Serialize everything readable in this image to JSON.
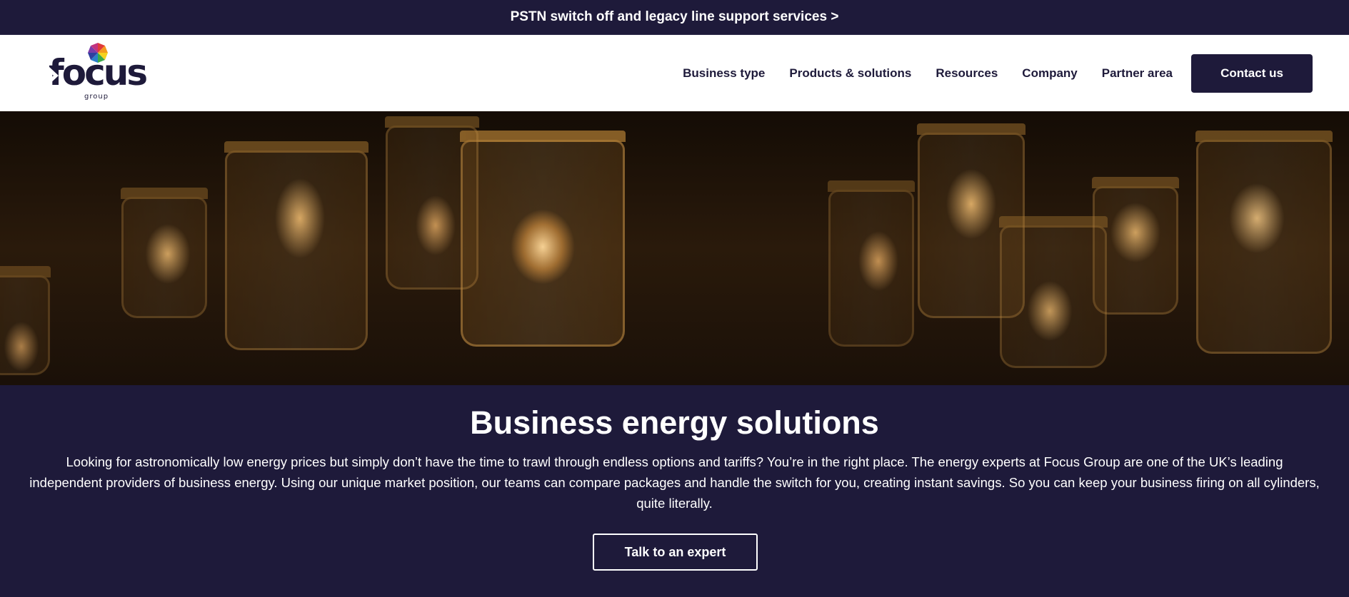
{
  "announcement": {
    "text": "PSTN switch off and legacy line support services >"
  },
  "logo": {
    "word": "focus",
    "sub": "group"
  },
  "nav": {
    "items": [
      {
        "label": "Business type"
      },
      {
        "label": "Products & solutions"
      },
      {
        "label": "Resources"
      },
      {
        "label": "Company"
      },
      {
        "label": "Partner area"
      }
    ],
    "contact_label": "Contact us"
  },
  "hero": {
    "image": "hanging-jar-lights-photo"
  },
  "main": {
    "title": "Business energy solutions",
    "description": "Looking for astronomically low energy prices but simply don’t have the time to trawl through endless options and tariffs? You’re in the right place. The energy experts at Focus Group are one of the UK’s leading independent providers of business energy. Using our unique market position, our teams can compare packages and handle the switch for you, creating instant savings. So you can keep your business firing on all cylinders, quite literally.",
    "cta_label": "Talk to an expert"
  },
  "colors": {
    "brand_navy": "#1e1a3a",
    "white": "#ffffff"
  }
}
